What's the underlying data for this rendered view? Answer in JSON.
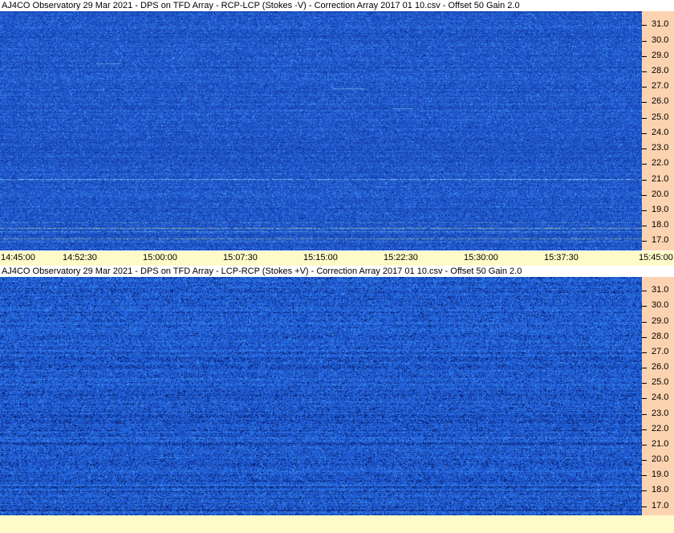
{
  "chart_data": [
    {
      "type": "heatmap",
      "title": "AJ4CO Observatory 29 Mar 2021  -  DPS on TFD Array  -  RCP-LCP (Stokes -V)  -  Correction Array 2017 01 10.csv  -  Offset 50  Gain 2.0",
      "x_ticks": [
        "14:45:00",
        "14:52:30",
        "15:00:00",
        "15:07:30",
        "15:15:00",
        "15:22:30",
        "15:30:00",
        "15:37:30",
        "15:45:00"
      ],
      "y_ticks": [
        "31.0",
        "30.0",
        "29.0",
        "28.0",
        "27.0",
        "26.0",
        "25.0",
        "24.0",
        "23.0",
        "22.0",
        "21.0",
        "20.0",
        "19.0",
        "18.0",
        "17.0"
      ],
      "x_range": [
        "14:45:00",
        "15:45:00"
      ],
      "y_range": [
        16.4,
        31.9
      ],
      "colors": {
        "background": "#1f55c8",
        "noise_light": "#3a86ee",
        "noise_dark": "#1035a0",
        "line_bright": "#9de8ff",
        "line_yellow": "#e8f070"
      }
    },
    {
      "type": "heatmap",
      "title": "AJ4CO Observatory 29 Mar 2021  -  DPS on TFD Array  -  LCP-RCP (Stokes +V)  -  Correction Array 2017 01 10.csv  -  Offset 50  Gain 2.0",
      "x_ticks": [],
      "y_ticks": [
        "31.0",
        "30.0",
        "29.0",
        "28.0",
        "27.0",
        "26.0",
        "25.0",
        "24.0",
        "23.0",
        "22.0",
        "21.0",
        "20.0",
        "19.0",
        "18.0",
        "17.0"
      ],
      "x_range": [
        "14:45:00",
        "15:45:00"
      ],
      "y_range": [
        16.4,
        31.9
      ],
      "colors": {
        "background": "#1e5ad2",
        "noise_light": "#3c8cf0",
        "noise_dark": "#0a1e70",
        "line_dark": "#050e40"
      }
    }
  ],
  "colors": {
    "axis_bg": "#fcd3b0",
    "time_axis_bg": "#fffbc8"
  }
}
